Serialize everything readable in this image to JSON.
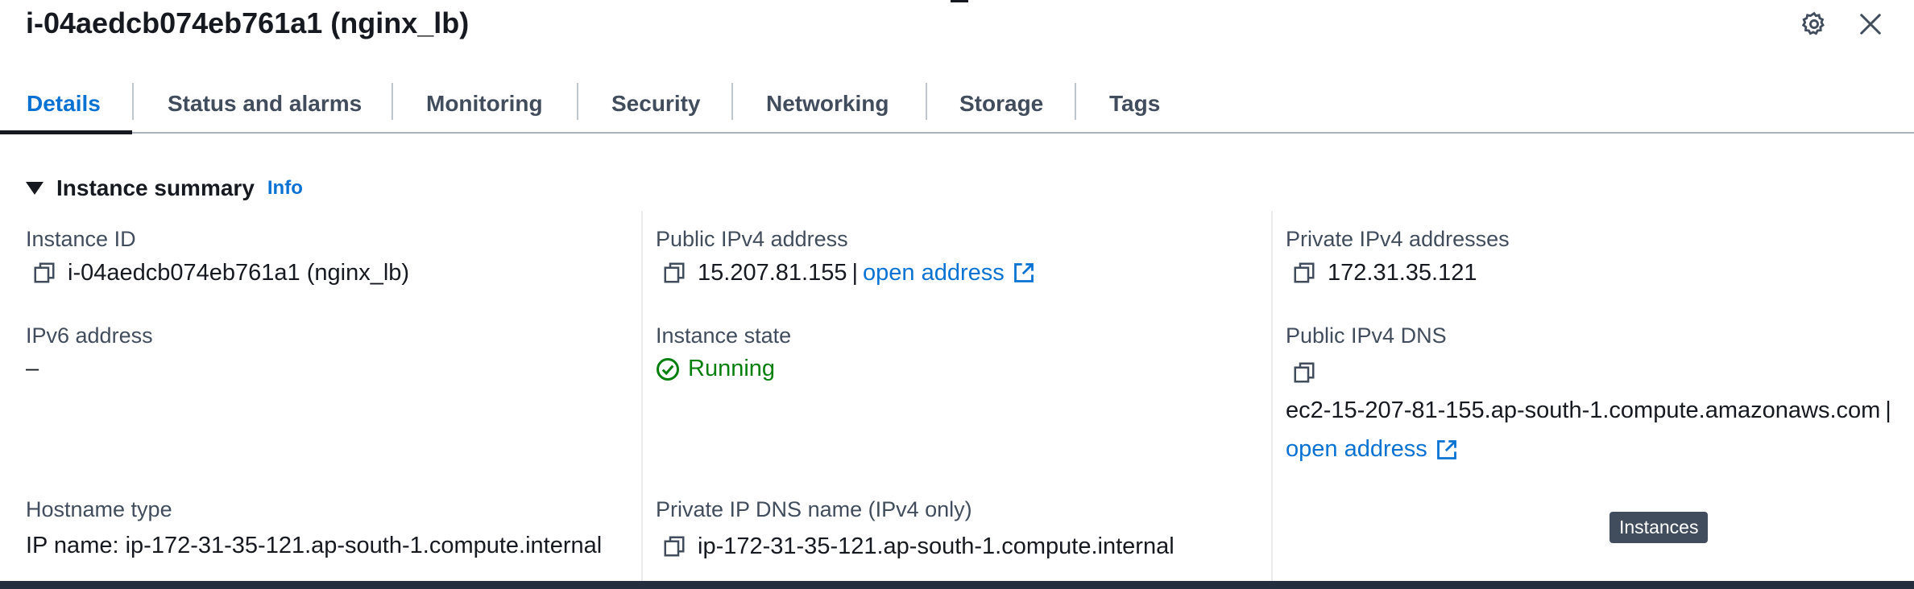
{
  "header": {
    "title": "i-04aedcb074eb761a1 (nginx_lb)",
    "settings_icon": "gear-icon",
    "close_icon": "close-icon"
  },
  "tabs": [
    {
      "label": "Details",
      "active": true
    },
    {
      "label": "Status and alarms"
    },
    {
      "label": "Monitoring"
    },
    {
      "label": "Security"
    },
    {
      "label": "Networking"
    },
    {
      "label": "Storage"
    },
    {
      "label": "Tags"
    }
  ],
  "section": {
    "title": "Instance summary",
    "info_label": "Info"
  },
  "fields": {
    "instance_id": {
      "label": "Instance ID",
      "value": "i-04aedcb074eb761a1 (nginx_lb)"
    },
    "public_ipv4": {
      "label": "Public IPv4 address",
      "value": "15.207.81.155",
      "separator": "|",
      "link": "open address"
    },
    "private_ipv4": {
      "label": "Private IPv4 addresses",
      "value": "172.31.35.121"
    },
    "ipv6": {
      "label": "IPv6 address",
      "value": "–"
    },
    "instance_state": {
      "label": "Instance state",
      "value": "Running"
    },
    "public_dns": {
      "label": "Public IPv4 DNS",
      "value": "ec2-15-207-81-155.ap-south-1.compute.amazonaws.com",
      "separator": "|",
      "link": "open address"
    },
    "hostname_type": {
      "label": "Hostname type",
      "value": "IP name: ip-172-31-35-121.ap-south-1.compute.internal"
    },
    "private_dns": {
      "label": "Private IP DNS name (IPv4 only)",
      "value": "ip-172-31-35-121.ap-south-1.compute.internal"
    }
  },
  "tooltip": "Instances",
  "colors": {
    "link": "#0972d3",
    "running": "#037f0c",
    "text": "#16191f",
    "label": "#414d5c"
  }
}
